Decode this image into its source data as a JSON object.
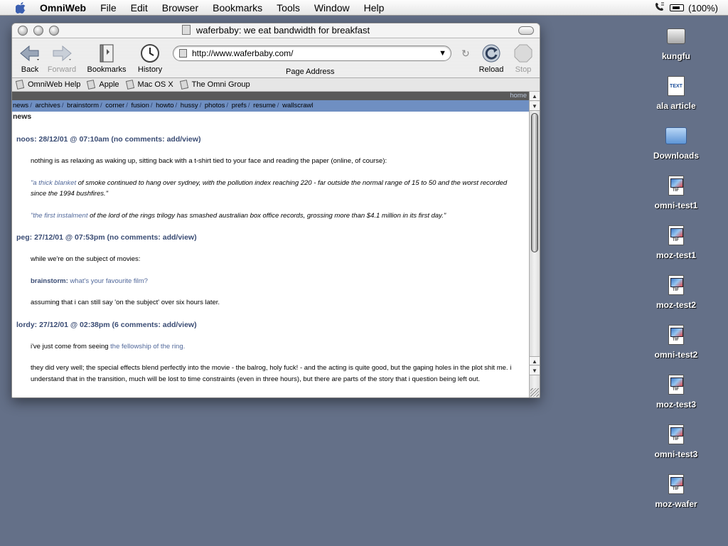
{
  "menubar": {
    "app_name": "OmniWeb",
    "items": [
      "File",
      "Edit",
      "Browser",
      "Bookmarks",
      "Tools",
      "Window",
      "Help"
    ],
    "battery": "(100%)"
  },
  "window": {
    "title": "waferbaby: we eat bandwidth for breakfast"
  },
  "toolbar": {
    "back": "Back",
    "forward": "Forward",
    "bookmarks": "Bookmarks",
    "history": "History",
    "url": "http://www.waferbaby.com/",
    "address_label": "Page Address",
    "reload": "Reload",
    "stop": "Stop"
  },
  "bookmark_bar": [
    "OmniWeb Help",
    "Apple",
    "Mac OS X",
    "The Omni Group"
  ],
  "page": {
    "home": "home",
    "nav": [
      "news",
      "archives",
      "brainstorm",
      "corner",
      "fusion",
      "howto",
      "hussy",
      "photos",
      "prefs",
      "resume",
      "wallscrawl"
    ],
    "section": "news",
    "entry1": {
      "head": "noos: 28/12/01 @ 07:10am (no comments:",
      "add": "add/view",
      "close": ")",
      "p1": "nothing is as relaxing as waking up, sitting back with a t-shirt tied to your face and reading the paper (online, of course):",
      "q1_link": "\"a thick blanket",
      "q1_text": " of smoke continued to hang over sydney, with the pollution index reaching 220 - far outside the normal range of 15 to 50 and the worst recorded since the 1994 bushfires.\"",
      "q2_link": "\"the first instalment",
      "q2_text": " of the lord of the rings trilogy has smashed australian box office records, grossing more than $4.1 million in its first day.\""
    },
    "entry2": {
      "head": "peg: 27/12/01 @ 07:53pm (no comments:",
      "add": "add/view",
      "close": ")",
      "p1": "while we're on the subject of movies:",
      "bs_label": "brainstorm:",
      "bs_link": "what's your favourite film?",
      "p2": "assuming that i can still say 'on the subject' over six hours later."
    },
    "entry3": {
      "head": "lordy: 27/12/01 @ 02:38pm (6 comments:",
      "add": "add/view",
      "close": ")",
      "p1_text": "i've just come from seeing ",
      "p1_link": "the fellowship of the ring.",
      "p2": "they did very well; the special effects blend perfectly into the movie - the balrog, holy fuck! - and the acting is quite good, but the gaping holes in the plot shit me. i understand that in the transition, much will be lost to time constraints (even in three hours), but there are parts of the story that i question being left out."
    }
  },
  "desktop_icons": [
    "kungfu",
    "ala article",
    "Downloads",
    "omni-test1",
    "moz-test1",
    "moz-test2",
    "omni-test2",
    "moz-test3",
    "omni-test3",
    "moz-wafer"
  ],
  "icon_texts": {
    "text_doc": "TEXT",
    "tif": "TIF"
  }
}
